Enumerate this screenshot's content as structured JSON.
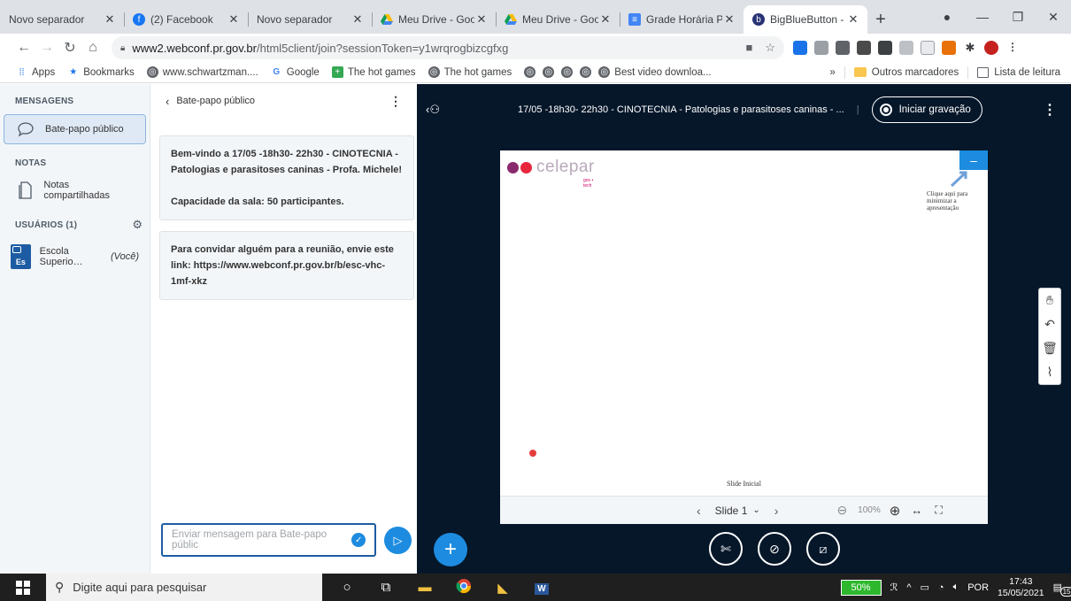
{
  "browser": {
    "tabs": [
      {
        "title": "Novo separador",
        "icon": "blank"
      },
      {
        "title": "(2) Facebook",
        "icon": "facebook"
      },
      {
        "title": "Novo separador",
        "icon": "blank"
      },
      {
        "title": "Meu Drive - Goo",
        "icon": "drive"
      },
      {
        "title": "Meu Drive - Goo",
        "icon": "drive"
      },
      {
        "title": "Grade Horária PC",
        "icon": "docs"
      },
      {
        "title": "BigBlueButton - ",
        "icon": "bbb"
      }
    ],
    "url_host": "www2.webconf.pr.gov.br",
    "url_path": "/html5client/join?sessionToken=y1wrqrogbizcgfxg",
    "bookmarks": [
      {
        "label": "Apps",
        "icon": "apps-grid"
      },
      {
        "label": "Bookmarks",
        "icon": "star"
      },
      {
        "label": "www.schwartzman....",
        "icon": "globe"
      },
      {
        "label": "Google",
        "icon": "google"
      },
      {
        "label": "The hot games",
        "icon": "green-plus"
      },
      {
        "label": "The hot games",
        "icon": "globe"
      }
    ],
    "bookmark_more": "Best video downloa...",
    "bookmarks_right": {
      "others": "Outros marcadores",
      "reading": "Lista de leitura",
      "overflow": "»"
    }
  },
  "sidebar": {
    "messages_header": "MENSAGENS",
    "public_chat": "Bate-papo público",
    "notes_header": "NOTAS",
    "shared_notes": "Notas compartilhadas",
    "users_header": "USUÁRIOS (1)",
    "user_name": "Escola Superio…",
    "user_you": "(Você)",
    "avatar_initials": "Es"
  },
  "chat": {
    "title": "Bate-papo público",
    "welcome_line1": "Bem-vindo a 17/05 -18h30- 22h30 - CINOTECNIA - Patologias e parasitoses caninas - Profa. Michele!",
    "welcome_line2": "Capacidade da sala: 50 participantes.",
    "invite": "Para convidar alguém para a reunião, envie este link: https://www.webconf.pr.gov.br/b/esc-vhc-1mf-xkz",
    "input_placeholder": "Enviar mensagem para Bate-papo públic"
  },
  "stage": {
    "title": "17/05 -18h30- 22h30 - CINOTECNIA - Patologias e parasitoses caninas - ...",
    "record_label": "Iniciar gravação",
    "slide_logo": "celepar",
    "slide_logo_sub": "gov • tech",
    "slide_hint": "Clique aqui para minimizar a apresentação",
    "slide_caption": "Slide Inicial",
    "slide_label": "Slide 1",
    "zoom": "100%"
  },
  "taskbar": {
    "search_placeholder": "Digite aqui para pesquisar",
    "battery": "50%",
    "lang": "POR",
    "time": "17:43",
    "date": "15/05/2021",
    "notifications": "15"
  },
  "colors": {
    "accent": "#1d8ce0",
    "stage_bg": "#06172a",
    "logo_purple": "#8a2a6e",
    "logo_red": "#e8263c"
  }
}
